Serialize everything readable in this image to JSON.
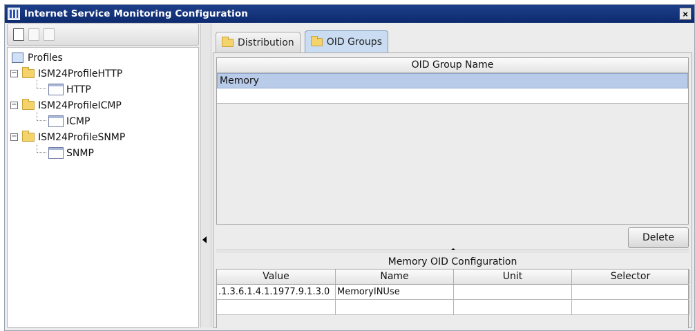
{
  "window": {
    "title": "Internet Service Monitoring Configuration",
    "close_glyph": "×"
  },
  "tree": {
    "root_label": "Profiles",
    "nodes": [
      {
        "label": "ISM24ProfileHTTP",
        "expander": "−",
        "child": "HTTP"
      },
      {
        "label": "ISM24ProfileICMP",
        "expander": "−",
        "child": "ICMP"
      },
      {
        "label": "ISM24ProfileSNMP",
        "expander": "−",
        "child": "SNMP"
      }
    ]
  },
  "tabs": [
    {
      "label": "Distribution",
      "selected": false
    },
    {
      "label": "OID Groups",
      "selected": true
    }
  ],
  "oid_groups": {
    "header": "OID Group Name",
    "rows": [
      "Memory",
      ""
    ]
  },
  "delete_label": "Delete",
  "oid_config": {
    "title": "Memory OID Configuration",
    "columns": [
      "Value",
      "Name",
      "Unit",
      "Selector"
    ],
    "rows": [
      [
        ".1.3.6.1.4.1.1977.9.1.3.0",
        "MemoryINUse",
        "",
        ""
      ],
      [
        "",
        "",
        "",
        ""
      ]
    ]
  },
  "colors": {
    "title_bar": "#0d2a6e",
    "selected_row": "#b8cbe8",
    "selected_tab": "#c9dcf2"
  },
  "icons": {
    "toolbar": [
      "new-icon",
      "copy-icon",
      "edit-icon"
    ],
    "tree_root": "computer-icon",
    "tree_node": "folder-icon",
    "tree_leaf": "page-icon"
  }
}
